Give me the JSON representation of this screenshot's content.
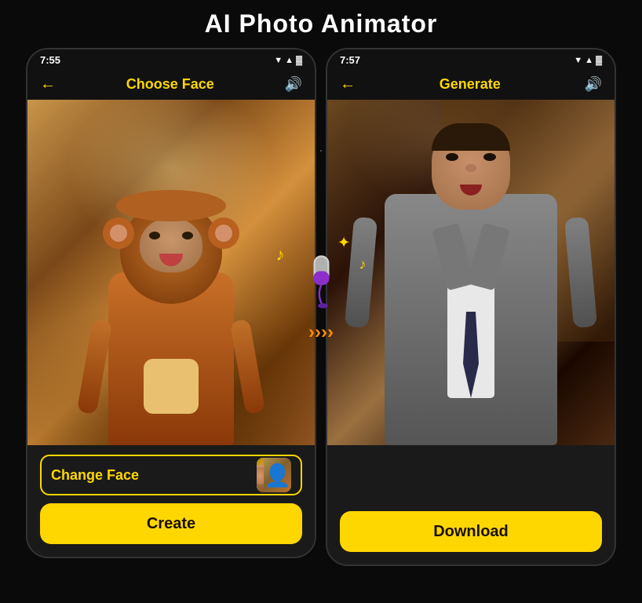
{
  "page": {
    "title": "AI Photo Animator",
    "background": "#0a0a0a"
  },
  "left_phone": {
    "status": {
      "time": "7:55",
      "icons": "▼4🔋"
    },
    "nav": {
      "back_label": "←",
      "title": "Choose Face",
      "sound_icon": "🔊"
    },
    "photo": {
      "description": "child in monkey costume",
      "emoji": "🐒"
    },
    "buttons": {
      "change_face_label": "Change Face",
      "create_label": "Create"
    }
  },
  "right_phone": {
    "status": {
      "time": "7:57",
      "icons": "▼4🔋"
    },
    "nav": {
      "back_label": "←",
      "title": "Generate",
      "sound_icon": "🔊"
    },
    "photo": {
      "description": "man in suit",
      "emoji": "🤵"
    },
    "buttons": {
      "download_label": "Download"
    }
  },
  "center": {
    "mic_color": "#8B2FC9",
    "mic_tip_color": "#d0d0d0",
    "note_color": "#FFD700",
    "arrow_color": "#FF8C00",
    "sparkle": "✦"
  }
}
